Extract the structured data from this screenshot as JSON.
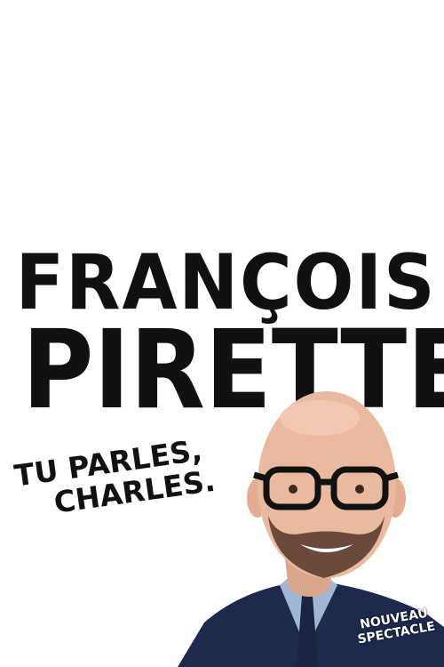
{
  "poster": {
    "name_line1": "FRANÇOIS",
    "name_line2": "PIRETTE",
    "subtitle_line1": "TU PARLES,",
    "subtitle_line2": "CHARLES.",
    "badge_line1": "NOUVEAU",
    "badge_line2": "SPECTACLE",
    "colors": {
      "text": "#111111",
      "background": "#ffffff",
      "suit": "#1d2a4e",
      "shirt": "#9fb6d6",
      "skin": "#e9b9a0"
    }
  }
}
